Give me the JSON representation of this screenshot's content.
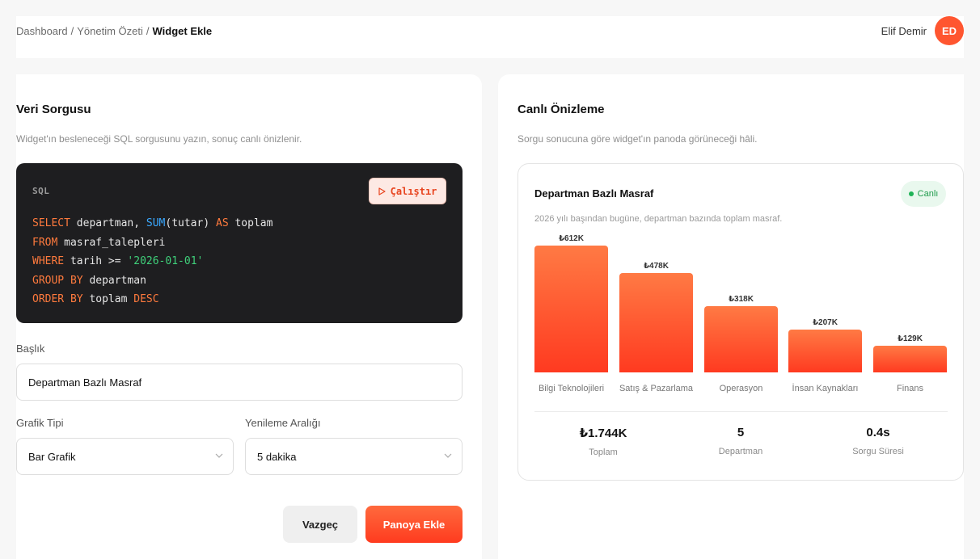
{
  "breadcrumb": {
    "items": [
      "Dashboard",
      "Yönetim Özeti"
    ],
    "current": "Widget Ekle",
    "separator": "/"
  },
  "user": {
    "name": "Elif Demir",
    "initials": "ED"
  },
  "left": {
    "title": "Veri Sorgusu",
    "subtitle": "Widget'ın besleneceği SQL sorgusunu yazın, sonuç canlı önizlenir.",
    "editor": {
      "language_label": "SQL",
      "run_icon": "play-icon",
      "run_label": "Çalıştır",
      "code_lines": [
        [
          {
            "t": "SELECT",
            "c": "kw"
          },
          {
            "t": " departman, "
          },
          {
            "t": "SUM",
            "c": "fn"
          },
          {
            "t": "(tutar) "
          },
          {
            "t": "AS",
            "c": "kw"
          },
          {
            "t": " toplam"
          }
        ],
        [
          {
            "t": "FROM",
            "c": "kw"
          },
          {
            "t": " masraf_talepleri"
          }
        ],
        [
          {
            "t": "WHERE",
            "c": "kw"
          },
          {
            "t": " tarih >= "
          },
          {
            "t": "'2026-01-01'",
            "c": "str"
          }
        ],
        [
          {
            "t": "GROUP BY",
            "c": "kw"
          },
          {
            "t": " departman"
          }
        ],
        [
          {
            "t": "ORDER BY",
            "c": "kw"
          },
          {
            "t": " toplam "
          },
          {
            "t": "DESC",
            "c": "kw"
          }
        ]
      ]
    },
    "fields": {
      "title_label": "Başlık",
      "title_value": "Departman Bazlı Masraf",
      "chart_type_label": "Grafik Tipi",
      "chart_type_value": "Bar Grafik",
      "refresh_label": "Yenileme Aralığı",
      "refresh_value": "5 dakika"
    },
    "actions": {
      "cancel": "Vazgeç",
      "add": "Panoya Ekle"
    }
  },
  "right": {
    "title": "Canlı Önizleme",
    "subtitle": "Sorgu sonucuna göre widget'ın panoda görüneceği hâli.",
    "card": {
      "title": "Departman Bazlı Masraf",
      "badge": "Canlı",
      "subtitle": "2026 yılı başından bugüne, departman bazında toplam masraf."
    },
    "stats": [
      {
        "value": "₺1.744K",
        "label": "Toplam"
      },
      {
        "value": "5",
        "label": "Departman"
      },
      {
        "value": "0.4s",
        "label": "Sorgu Süresi"
      }
    ]
  },
  "chart_data": {
    "type": "bar",
    "categories": [
      "Bilgi Teknolojileri",
      "Satış & Pazarlama",
      "Operasyon",
      "İnsan Kaynakları",
      "Finans"
    ],
    "values": [
      612,
      478,
      318,
      207,
      129
    ],
    "value_labels": [
      "₺612K",
      "₺478K",
      "₺318K",
      "₺207K",
      "₺129K"
    ],
    "ylim": [
      0,
      612
    ],
    "grid": false
  },
  "colors": {
    "accent": "#ff5630",
    "success": "#1fb357",
    "editor_bg": "#1e1e20"
  }
}
